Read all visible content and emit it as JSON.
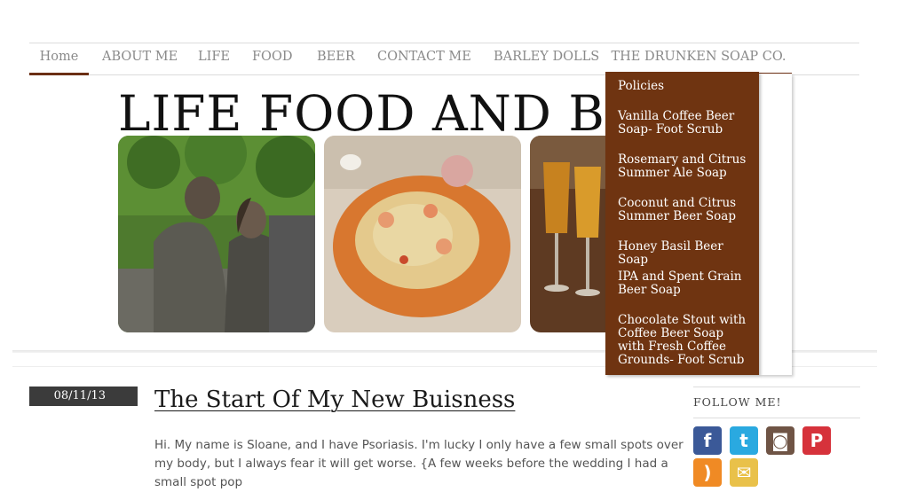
{
  "nav": {
    "items": [
      {
        "label": "Home",
        "active": true
      },
      {
        "label": "ABOUT ME"
      },
      {
        "label": "LIFE"
      },
      {
        "label": "FOOD"
      },
      {
        "label": "BEER"
      },
      {
        "label": "CONTACT ME"
      },
      {
        "label": "BARLEY DOLLS"
      },
      {
        "label": "THE DRUNKEN SOAP CO.",
        "active": true
      }
    ],
    "dropdown": [
      {
        "label": "Policies"
      },
      {
        "label": "Vanilla Coffee Beer Soap- Foot Scrub"
      },
      {
        "label": "Rosemary and Citrus Summer Ale Soap"
      },
      {
        "label": "Coconut and Citrus Summer Beer Soap"
      },
      {
        "label": "Honey Basil Beer Soap"
      },
      {
        "label": "IPA and Spent Grain Beer Soap"
      },
      {
        "label": "Chocolate Stout with Coffee Beer Soap with Fresh Coffee Grounds- Foot Scrub"
      }
    ]
  },
  "header": {
    "title": "LIFE FOOD AND BEER"
  },
  "post": {
    "date": "08/11/13",
    "title": "The Start Of My New Buisness",
    "body": "Hi. My name is Sloane, and I have Psoriasis. I'm lucky I only have a few small spots over my body, but I always fear it will get worse. {A few weeks before the wedding I had a small spot pop"
  },
  "sidebar": {
    "follow_title": "FOLLOW ME!",
    "social": [
      {
        "name": "facebook",
        "glyph": "f"
      },
      {
        "name": "twitter",
        "glyph": "t"
      },
      {
        "name": "instagram",
        "glyph": "◙"
      },
      {
        "name": "pinterest",
        "glyph": "P"
      },
      {
        "name": "rss",
        "glyph": ")"
      },
      {
        "name": "email",
        "glyph": "✉"
      }
    ]
  },
  "colors": {
    "accent": "#6f3411",
    "nav_text": "#8a8a8a",
    "date_bg": "#3b3b3b"
  }
}
